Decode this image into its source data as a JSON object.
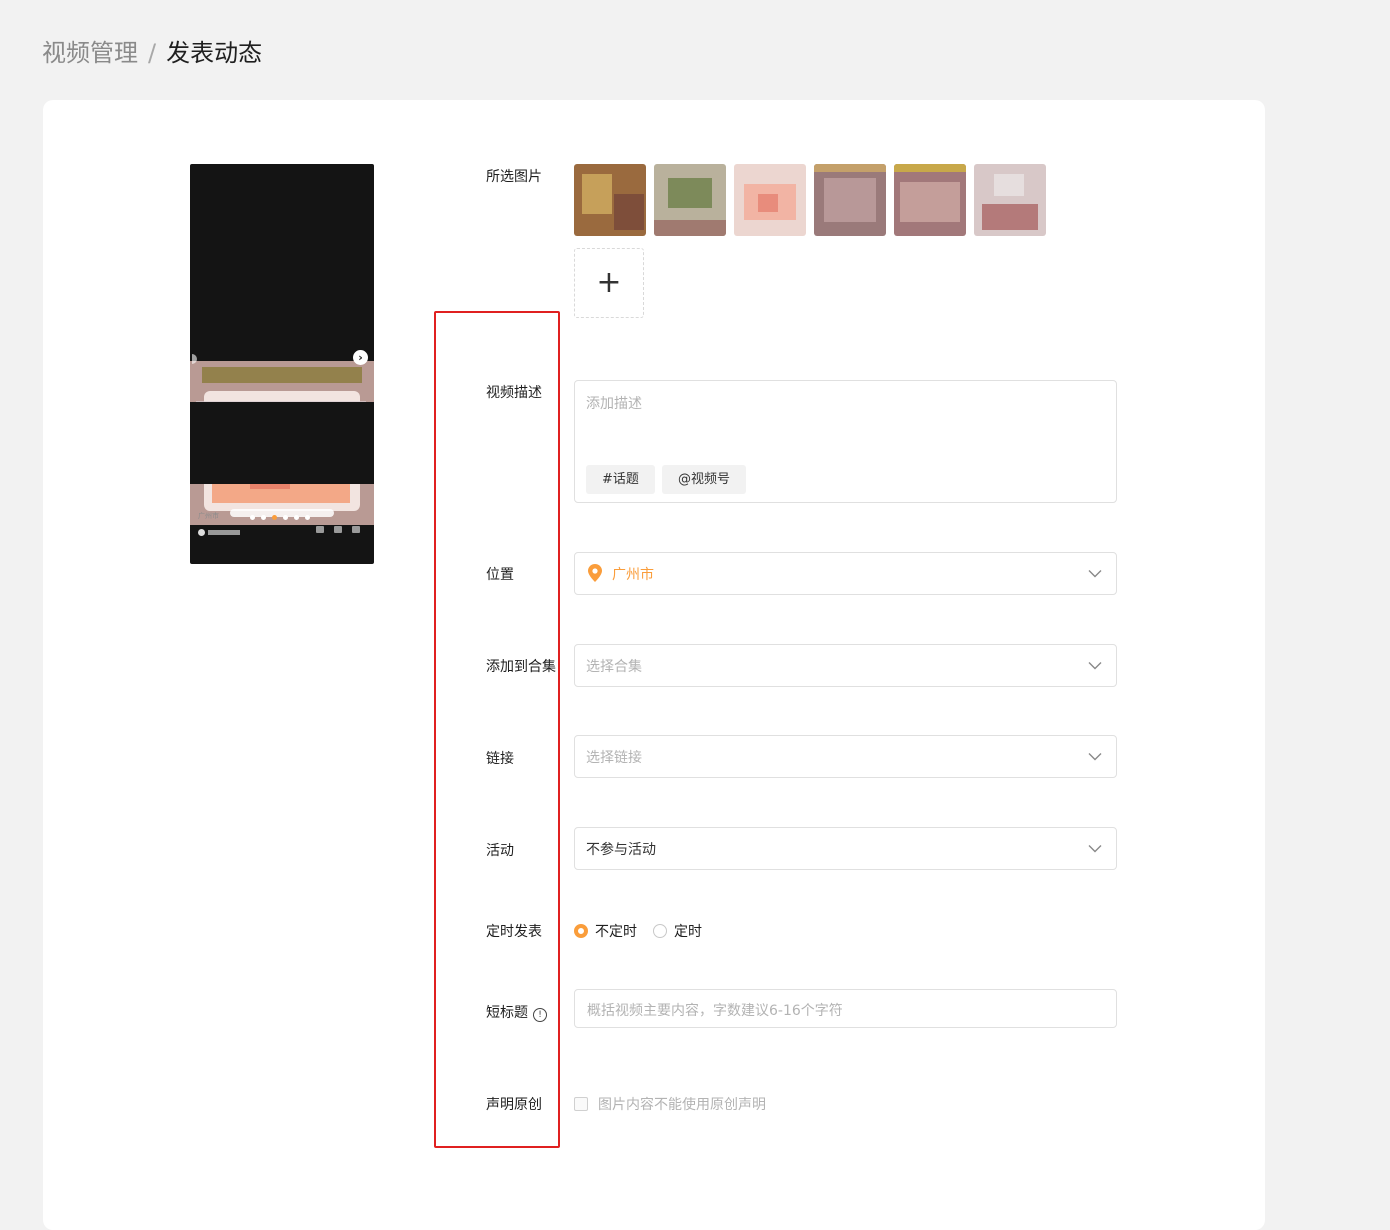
{
  "breadcrumb": {
    "parent": "视频管理",
    "separator": "/",
    "current": "发表动态"
  },
  "preview": {
    "city": "广州市",
    "active_dot": 2,
    "dot_count": 6
  },
  "form": {
    "images_label": "所选图片",
    "add_image_symbol": "+",
    "description": {
      "label": "视频描述",
      "placeholder": "添加描述",
      "topic_button": "#话题",
      "channel_button": "@视频号"
    },
    "location": {
      "label": "位置",
      "value": "广州市"
    },
    "collection": {
      "label": "添加到合集",
      "placeholder": "选择合集"
    },
    "link": {
      "label": "链接",
      "placeholder": "选择链接"
    },
    "activity": {
      "label": "活动",
      "value": "不参与活动"
    },
    "schedule": {
      "label": "定时发表",
      "options": [
        "不定时",
        "定时"
      ],
      "selected": "不定时"
    },
    "short_title": {
      "label": "短标题",
      "placeholder": "概括视频主要内容，字数建议6-16个字符"
    },
    "original": {
      "label": "声明原创",
      "note": "图片内容不能使用原创声明"
    }
  },
  "colors": {
    "accent": "#fa9d3b",
    "highlight": "#e02020",
    "card": "#ffffff",
    "page": "#f2f2f2"
  }
}
